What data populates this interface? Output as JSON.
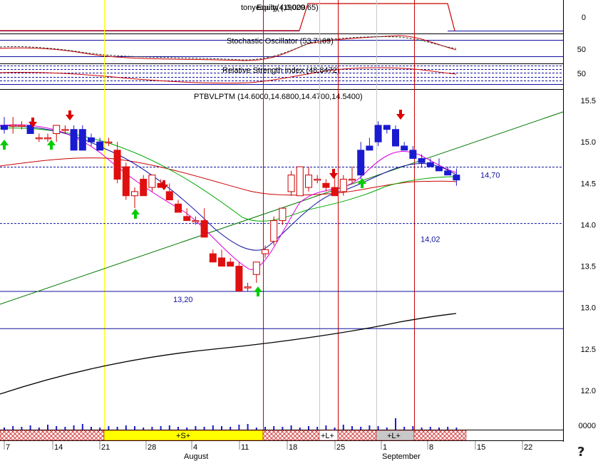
{
  "panels": {
    "equity_title": "tonyequity(4,0,000",
    "equity_overlay": "Equity (19029.65)",
    "stochastic_title": "Stochastic Oscillator (53.7169)",
    "rsi_title": "Relative Strength Index (48.8472)",
    "price_title": "PTBVLPTM (14.6000,14.6800,14.4700,14.5400)"
  },
  "right_axis": {
    "equity_ticks": [
      "0"
    ],
    "stochastic_ticks": [
      "50"
    ],
    "rsi_ticks": [
      "50"
    ],
    "price_ticks": [
      "15.5",
      "15.0",
      "14.5",
      "14.0",
      "13.5",
      "13.0",
      "12.5",
      "12.0"
    ],
    "volume_tick": "0000"
  },
  "date_axis": {
    "ticks": [
      "7",
      "14",
      "21",
      "28",
      "4",
      "11",
      "18",
      "25",
      "1",
      "8",
      "15",
      "22"
    ],
    "months": [
      "August",
      "September"
    ]
  },
  "bands": [
    {
      "label": "+S+",
      "color": "#ffff00"
    },
    {
      "label": "+L+",
      "color": "#ffffff"
    },
    {
      "label": "+L+",
      "color": "#c8c8c8"
    }
  ],
  "help_glyph": "?",
  "chart_data": {
    "type": "candlestick",
    "title": "PTBVLPTM (14.6000,14.6800,14.4700,14.5400)",
    "ylim": [
      11.6,
      15.6
    ],
    "price_lines": [
      {
        "label": "14,70",
        "value": 14.7,
        "color": "#1010a0"
      },
      {
        "label": "14,02",
        "value": 14.02,
        "color": "#1010a0"
      },
      {
        "label": "13,20",
        "value": 13.2,
        "color": "#1010a0"
      },
      {
        "label": "",
        "value": 12.75,
        "color": "#1010a0"
      }
    ],
    "candles": [
      [
        15.2,
        15.3,
        15.1,
        15.15
      ],
      [
        15.2,
        15.3,
        15.1,
        15.2
      ],
      [
        15.2,
        15.25,
        15.15,
        15.2
      ],
      [
        15.2,
        15.25,
        15.1,
        15.1
      ],
      [
        15.05,
        15.1,
        15.0,
        15.05
      ],
      [
        15.05,
        15.1,
        15.0,
        15.05
      ],
      [
        15.1,
        15.2,
        15.0,
        15.2
      ],
      [
        15.15,
        15.2,
        15.1,
        15.15
      ],
      [
        15.15,
        15.2,
        14.9,
        14.9
      ],
      [
        15.15,
        15.2,
        14.9,
        14.9
      ],
      [
        15.05,
        15.1,
        14.95,
        15.0
      ],
      [
        15.0,
        15.05,
        14.9,
        14.9
      ],
      [
        15.0,
        15.05,
        14.95,
        15.0
      ],
      [
        14.9,
        15.0,
        14.5,
        14.55
      ],
      [
        14.7,
        14.75,
        14.3,
        14.35
      ],
      [
        14.35,
        14.45,
        14.2,
        14.4
      ],
      [
        14.55,
        14.6,
        14.35,
        14.35
      ],
      [
        14.45,
        14.6,
        14.4,
        14.6
      ],
      [
        14.5,
        14.55,
        14.45,
        14.45
      ],
      [
        14.4,
        14.5,
        14.3,
        14.3
      ],
      [
        14.25,
        14.3,
        14.15,
        14.15
      ],
      [
        14.1,
        14.2,
        14.05,
        14.05
      ],
      [
        14.05,
        14.1,
        14.0,
        14.05
      ],
      [
        14.05,
        14.2,
        13.85,
        13.85
      ],
      [
        13.65,
        13.7,
        13.55,
        13.55
      ],
      [
        13.6,
        13.7,
        13.5,
        13.5
      ],
      [
        13.55,
        13.6,
        13.5,
        13.5
      ],
      [
        13.5,
        13.55,
        13.2,
        13.2
      ],
      [
        13.25,
        13.3,
        13.2,
        13.25
      ],
      [
        13.4,
        13.55,
        13.3,
        13.55
      ],
      [
        13.65,
        13.75,
        13.6,
        13.7
      ],
      [
        13.8,
        14.1,
        13.75,
        14.05
      ],
      [
        14.05,
        14.2,
        14.0,
        14.2
      ],
      [
        14.4,
        14.65,
        14.35,
        14.6
      ],
      [
        14.35,
        14.7,
        14.35,
        14.7
      ],
      [
        14.45,
        14.7,
        14.4,
        14.6
      ],
      [
        14.55,
        14.6,
        14.5,
        14.55
      ],
      [
        14.5,
        14.55,
        14.4,
        14.45
      ],
      [
        14.45,
        14.6,
        14.35,
        14.35
      ],
      [
        14.4,
        14.6,
        14.35,
        14.55
      ],
      [
        14.55,
        14.7,
        14.5,
        14.55
      ],
      [
        14.9,
        15.0,
        14.55,
        14.6
      ],
      [
        14.95,
        15.05,
        14.9,
        14.9
      ],
      [
        15.2,
        15.25,
        14.95,
        15.0
      ],
      [
        15.2,
        15.2,
        15.1,
        15.15
      ],
      [
        15.15,
        15.2,
        14.95,
        14.95
      ],
      [
        14.95,
        15.0,
        14.9,
        14.9
      ],
      [
        14.9,
        14.95,
        14.8,
        14.8
      ],
      [
        14.8,
        14.85,
        14.7,
        14.75
      ],
      [
        14.75,
        14.8,
        14.7,
        14.7
      ],
      [
        14.7,
        14.8,
        14.65,
        14.65
      ],
      [
        14.65,
        14.7,
        14.6,
        14.6
      ],
      [
        14.6,
        14.68,
        14.47,
        14.54
      ]
    ]
  }
}
